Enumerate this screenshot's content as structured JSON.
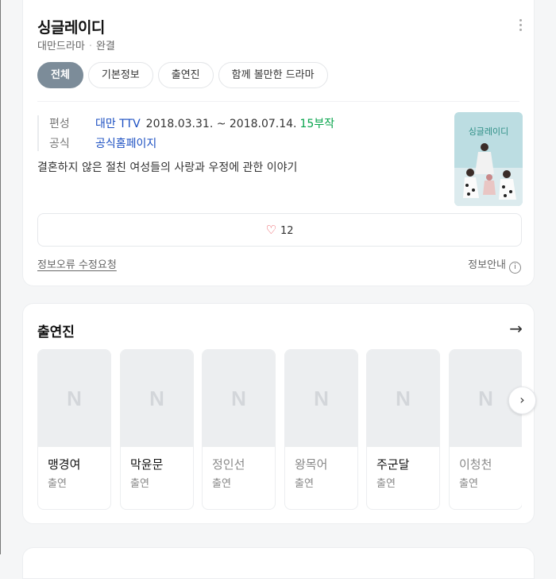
{
  "info": {
    "title": "싱글레이디",
    "category": "대만드라마",
    "status": "완결",
    "more_icon": "more-vertical-icon",
    "tabs": [
      {
        "label": "전체",
        "active": true
      },
      {
        "label": "기본정보",
        "active": false
      },
      {
        "label": "출연진",
        "active": false
      },
      {
        "label": "함께 볼만한 드라마",
        "active": false
      }
    ],
    "fields": {
      "broadcast_label": "편성",
      "broadcast_channel": "대만 TTV",
      "broadcast_period": "2018.03.31. ~ 2018.07.14.",
      "broadcast_episodes": "15부작",
      "official_label": "공식",
      "official_link": "공식홈페이지"
    },
    "description": "결혼하지 않은 절친 여성들의 사랑과 우정에 관한 이야기",
    "poster_title": "싱글레이디",
    "like_icon": "heart-icon",
    "like_count": "12",
    "report_link": "정보오류 수정요청",
    "info_guide": "정보안내",
    "info_icon": "info-icon"
  },
  "cast": {
    "title": "출연진",
    "arrow_icon": "arrow-right-icon",
    "placeholder_letter": "N",
    "next_icon": "chevron-right-icon",
    "people": [
      {
        "name": "맹경여",
        "role": "출연"
      },
      {
        "name": "막윤문",
        "role": "출연"
      },
      {
        "name": "정인선",
        "role": "출연"
      },
      {
        "name": "왕목어",
        "role": "출연"
      },
      {
        "name": "주군달",
        "role": "출연"
      },
      {
        "name": "이청천",
        "role": "출연"
      }
    ]
  },
  "colors": {
    "active_tab": "#7c8c99",
    "link": "#1b4fc2",
    "episodes": "#05a34a",
    "heart": "#e8464e"
  }
}
